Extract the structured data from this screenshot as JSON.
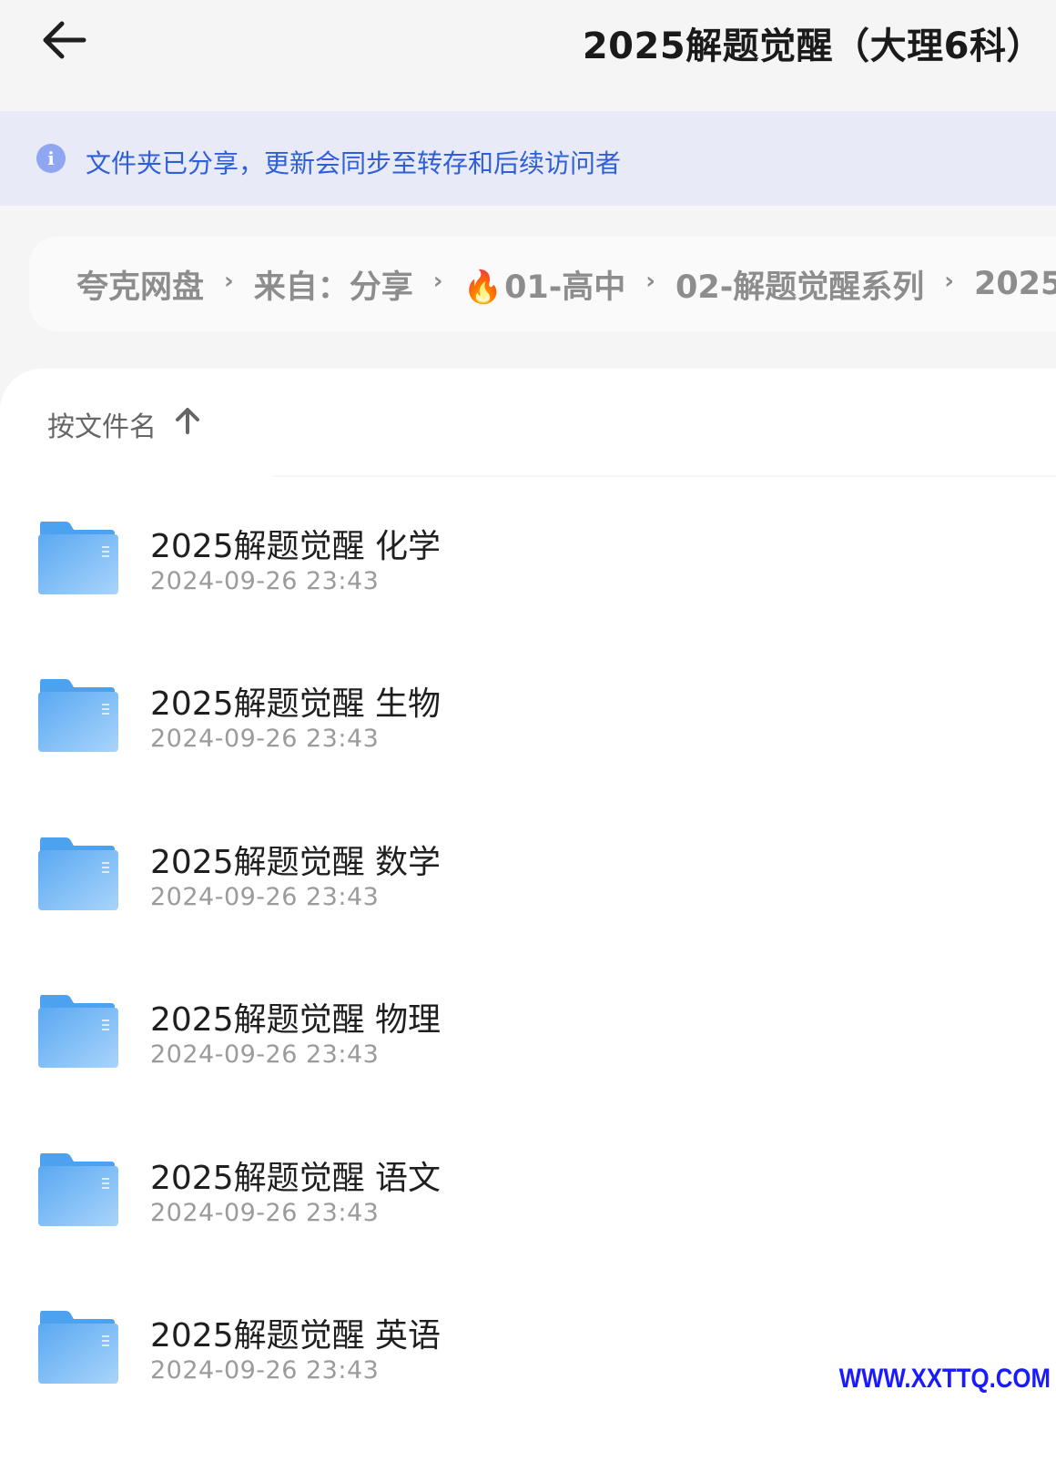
{
  "header": {
    "back_icon": "arrow-left-icon",
    "title": "2025解题觉醒（大理6科）"
  },
  "notice": {
    "icon": "info-icon",
    "icon_glyph": "i",
    "text": "文件夹已分享，更新会同步至转存和后续访问者"
  },
  "breadcrumb": {
    "items": [
      "夸克网盘",
      "来自：分享",
      "01-高中",
      "02-解题觉醒系列",
      "2025"
    ],
    "flame_icon": "🔥",
    "separator": "›"
  },
  "sort": {
    "label": "按文件名",
    "arrow": "↑"
  },
  "files": [
    {
      "name": "2025解题觉醒 化学",
      "date": "2024-09-26 23:43"
    },
    {
      "name": "2025解题觉醒 生物",
      "date": "2024-09-26 23:43"
    },
    {
      "name": "2025解题觉醒 数学",
      "date": "2024-09-26 23:43"
    },
    {
      "name": "2025解题觉醒 物理",
      "date": "2024-09-26 23:43"
    },
    {
      "name": "2025解题觉醒 语文",
      "date": "2024-09-26 23:43"
    },
    {
      "name": "2025解题觉醒 英语",
      "date": "2024-09-26 23:43"
    }
  ],
  "watermark": "WWW.XXTTQ.COM",
  "colors": {
    "accent_blue": "#2f5fd8",
    "notice_bg": "#e8ebf7",
    "folder_blue": "#6fb6f5"
  }
}
